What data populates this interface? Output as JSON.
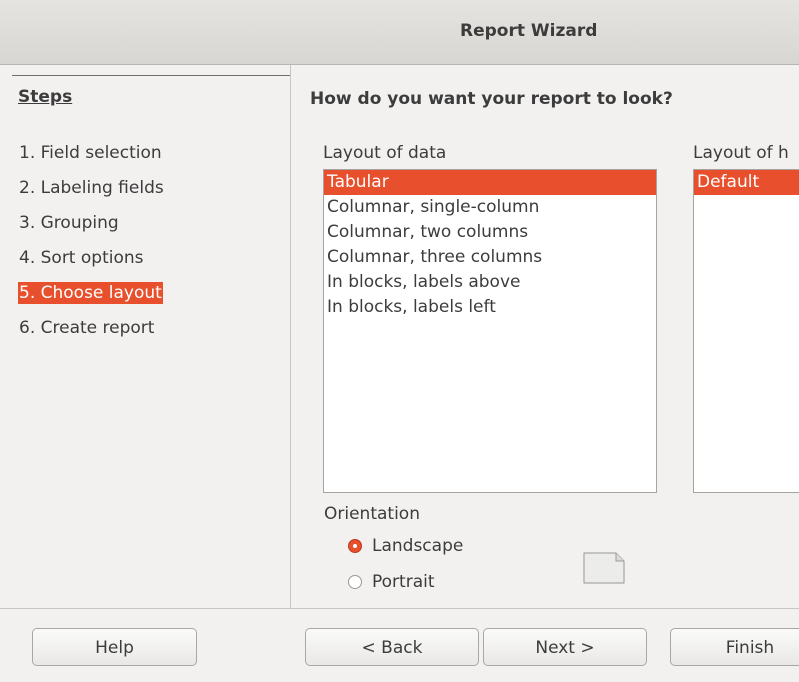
{
  "window": {
    "title": "Report Wizard"
  },
  "steps": {
    "heading": "Steps",
    "items": [
      {
        "label": "1. Field selection",
        "active": false
      },
      {
        "label": "2. Labeling fields",
        "active": false
      },
      {
        "label": "3. Grouping",
        "active": false
      },
      {
        "label": "4. Sort options",
        "active": false
      },
      {
        "label": "5. Choose layout",
        "active": true
      },
      {
        "label": "6. Create report",
        "active": false
      }
    ]
  },
  "main": {
    "question": "How do you want your report to look?",
    "layout_of_data": {
      "label": "Layout of data",
      "items": [
        {
          "label": "Tabular",
          "selected": true
        },
        {
          "label": "Columnar, single-column",
          "selected": false
        },
        {
          "label": "Columnar, two columns",
          "selected": false
        },
        {
          "label": "Columnar, three columns",
          "selected": false
        },
        {
          "label": "In blocks, labels above",
          "selected": false
        },
        {
          "label": "In blocks, labels left",
          "selected": false
        }
      ]
    },
    "layout_of_headers": {
      "label": "Layout of h",
      "items": [
        {
          "label": "Default",
          "selected": true
        }
      ]
    },
    "orientation": {
      "label": "Orientation",
      "options": [
        {
          "label": "Landscape",
          "checked": true
        },
        {
          "label": "Portrait",
          "checked": false
        }
      ]
    }
  },
  "buttons": {
    "help": "Help",
    "back": "< Back",
    "next": "Next >",
    "finish": "Finish"
  },
  "colors": {
    "accent": "#e8502d",
    "background": "#f2f1f0"
  }
}
